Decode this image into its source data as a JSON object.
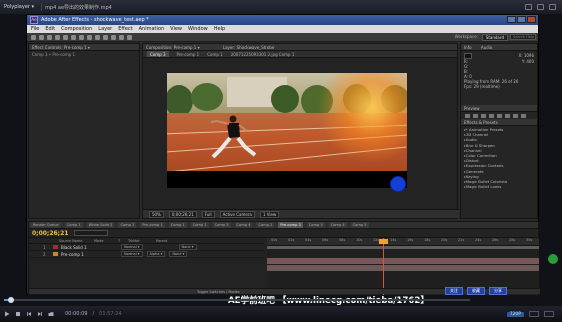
{
  "player": {
    "brand": "Polyplayer ▾",
    "file_title": "mp4  ae导出的效果制作.mp4",
    "current_time": "00:00:09",
    "total_time": "01:57:24",
    "progress_fraction": 0.015,
    "quality_label": "720P",
    "watermark": "AE学前班吧  【www.linecg.com/tieba/1762】",
    "bottom_buttons": [
      "关注",
      "收藏",
      "分享"
    ]
  },
  "ae": {
    "title": "Adobe After Effects - shockwave_test.aep *",
    "logo": "Ae",
    "menu": [
      "File",
      "Edit",
      "Composition",
      "Layer",
      "Effect",
      "Animation",
      "View",
      "Window",
      "Help"
    ],
    "workspace_label": "Workspace:",
    "workspace_value": "Standard",
    "search_placeholder": "Search Help"
  },
  "left_panel": {
    "tab": "Effect Controls: Pre-comp 1  ▾",
    "subtitle": "Comp 3 • Pre-comp 1"
  },
  "comp_panel": {
    "tab": "Composition: Pre-comp 1  ▾",
    "layer_tab": "Layer: Shockwave_Strobe",
    "sub_tabs": [
      "Comp 3",
      "Pre-comp 1",
      "Comp 1",
      "20071225093301 2.jpg Comp 1"
    ],
    "zoom": "50%",
    "timecode": "0;00;26;21",
    "resolution": "Full",
    "camera": "Active Camera",
    "view": "1 View"
  },
  "right_panel": {
    "info_tab": "Info",
    "audio_tab": "Audio",
    "r": "R:",
    "g": "G:",
    "b": "B:",
    "a": "A: 0",
    "x": "X: 1096",
    "y": "Y: 400",
    "playing": "Playing from RAM: 26 of 26",
    "fps": "Fps: 29 (realtime)",
    "preview_tab": "Preview",
    "effects_tab": "Effects & Presets",
    "effects": [
      "* Animation Presets",
      "3D Channel",
      "Audio",
      "Blur & Sharpen",
      "Channel",
      "Color Correction",
      "Distort",
      "Expression Controls",
      "Generate",
      "Keying",
      "Magic Bullet Colorista",
      "Magic Bullet Looks"
    ]
  },
  "timeline": {
    "tabs": [
      "Render Queue",
      "Comp 1",
      "White Solid 2",
      "Comp 2",
      "Pre-comp 1",
      "Comp 1",
      "Comp 1",
      "Comp 3",
      "Comp 4",
      "Comp 2",
      "Pre-comp 3",
      "Comp 3",
      "Comp 4",
      "Comp 5"
    ],
    "active_tab_index": 10,
    "time": "0;00;26;21",
    "columns": [
      "Source Name",
      "Mode",
      "T",
      "TrkMat",
      "Parent"
    ],
    "layers": [
      {
        "num": "1",
        "name": "Black Solid 1",
        "mode": "Normal ▾",
        "trkmat": "",
        "parent": "None ▾",
        "color": "#a03030"
      },
      {
        "num": "2",
        "name": "Pre-comp 1",
        "mode": "Normal ▾",
        "trkmat": "Alpha ▾",
        "parent": "None ▾",
        "color": "#c08a30"
      }
    ],
    "ruler_ticks": [
      "00s",
      "02s",
      "04s",
      "06s",
      "08s",
      "10s",
      "12s",
      "14s",
      "16s",
      "18s",
      "20s",
      "22s",
      "24s",
      "26s",
      "28s",
      "30s"
    ],
    "toggle_label": "Toggle Switches / Modes"
  },
  "colors": {
    "timecode": "#f0c040",
    "playhead": "#e05040",
    "layer1": "#7b5656",
    "cursor": "#1540d8"
  }
}
